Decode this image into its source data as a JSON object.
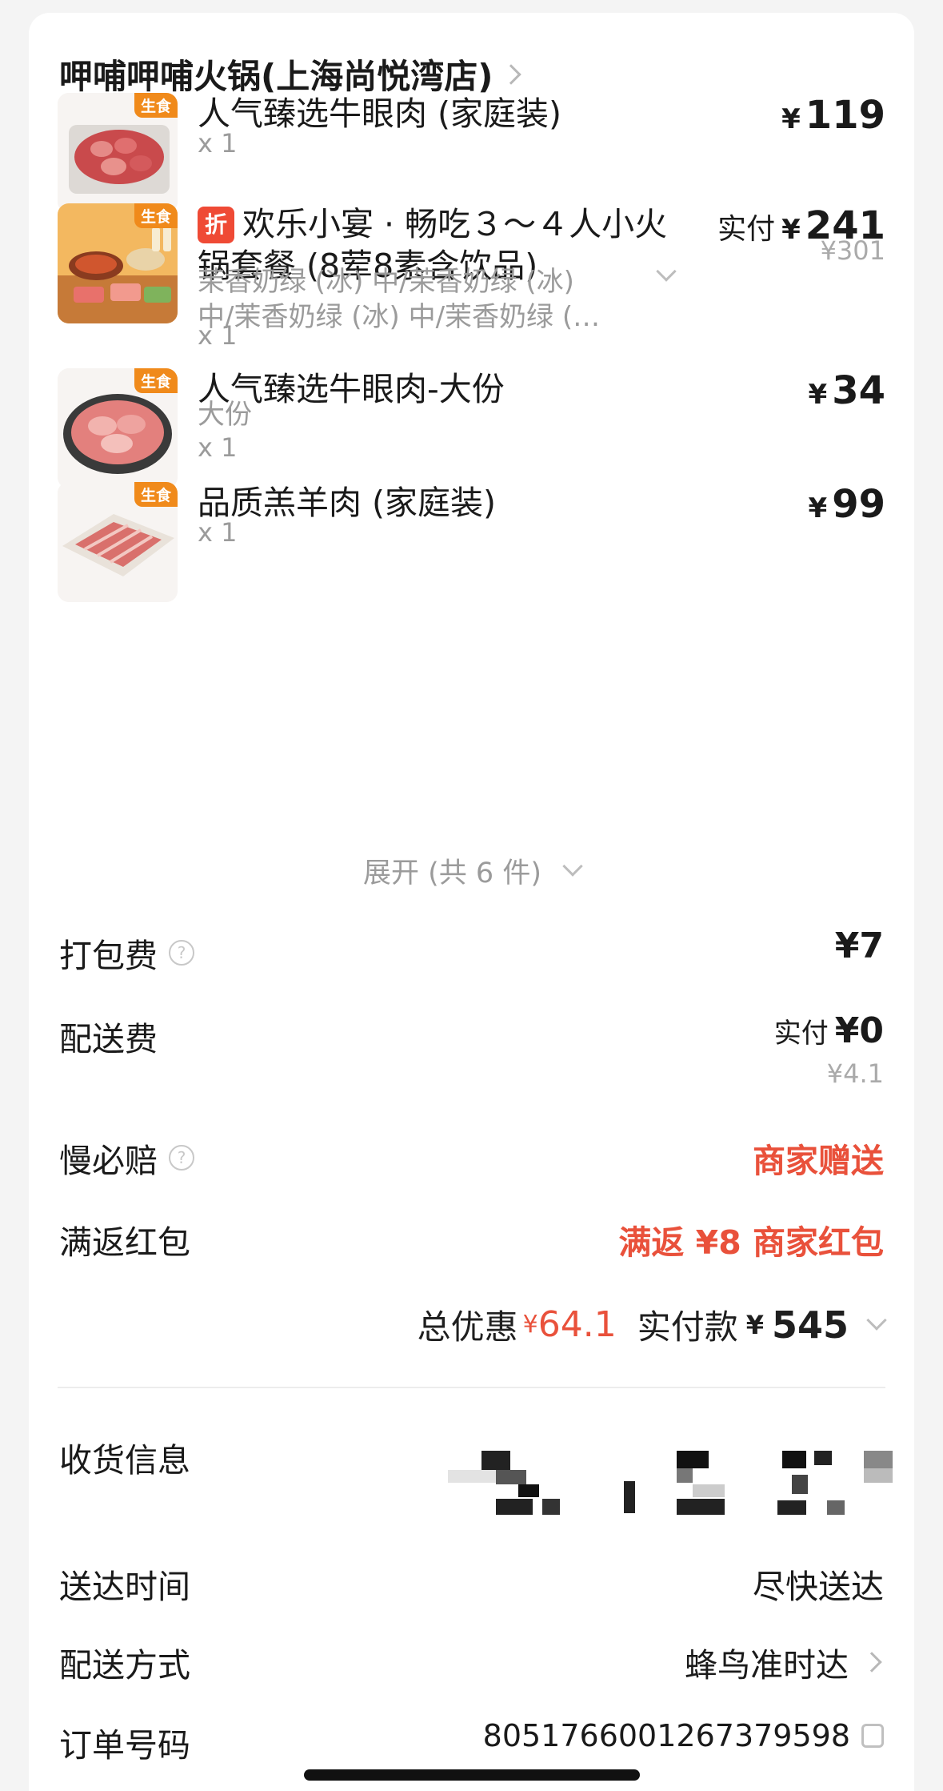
{
  "store": {
    "name": "呷哺呷哺火锅(上海尚悦湾店)"
  },
  "items": [
    {
      "tag": "生食",
      "name": "人气臻选牛眼肉 (家庭装)",
      "qty": "x 1",
      "price_currency": "¥",
      "price": "119"
    },
    {
      "tag": "生食",
      "discount_badge": "折",
      "name": "欢乐小宴 · 畅吃３～４人小火锅套餐 (8荤8素含饮品)",
      "options": "茉香奶绿 (冰) 中/茉香奶绿 (冰) 中/茉香奶绿 (冰) 中/茉香奶绿 (…",
      "options_line1": "茉香奶绿 (冰) 中/茉香奶绿 (冰)",
      "options_line2": "中/茉香奶绿 (冰) 中/茉香奶绿 (…",
      "qty": "x 1",
      "price_prefix": "实付",
      "price_currency": "¥",
      "price": "241",
      "original_price": "¥301"
    },
    {
      "tag": "生食",
      "name": "人气臻选牛眼肉-大份",
      "spec": "大份",
      "qty": "x 1",
      "price_currency": "¥",
      "price": "34"
    },
    {
      "tag": "生食",
      "name": "品质羔羊肉 (家庭装)",
      "qty": "x 1",
      "price_currency": "¥",
      "price": "99"
    }
  ],
  "expand_label": "展开 (共 6 件)",
  "fees": {
    "packing": {
      "label": "打包费",
      "value": "¥7"
    },
    "delivery": {
      "label": "配送费",
      "prefix": "实付",
      "value": "¥0",
      "original": "¥4.1"
    },
    "late_compensation": {
      "label": "慢必赔",
      "value": "商家赠送"
    },
    "cashback": {
      "label": "满返红包",
      "value": "满返 ¥8 商家红包"
    }
  },
  "totals": {
    "discount_label": "总优惠",
    "discount_currency": "¥",
    "discount_value": "64.1",
    "paid_label": "实付款",
    "paid_currency": "¥",
    "paid_value": "545"
  },
  "info": {
    "receiver": {
      "label": "收货信息"
    },
    "delivery_time": {
      "label": "送达时间",
      "value": "尽快送达"
    },
    "delivery_method": {
      "label": "配送方式",
      "value": "蜂鸟准时达"
    },
    "order_number": {
      "label": "订单号码",
      "value": "8051766001267379598"
    }
  },
  "colors": {
    "accent_red": "#e9513b",
    "tag_orange": "#f08a1b",
    "badge_red": "#ef4a35"
  }
}
